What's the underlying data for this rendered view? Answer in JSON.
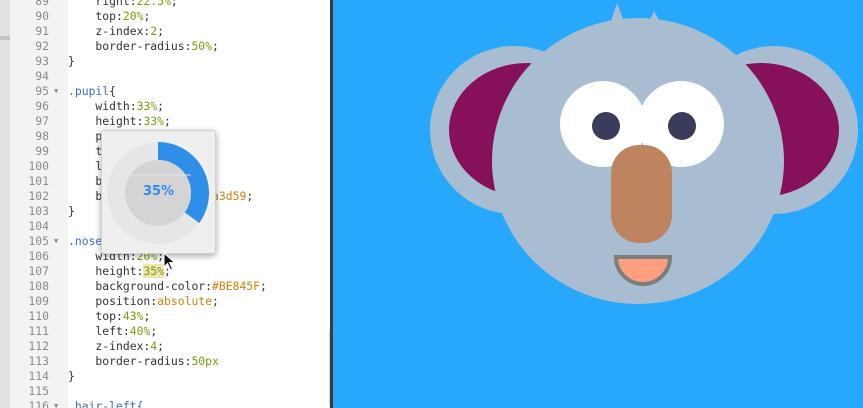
{
  "colors": {
    "editor_bg": "#ffffff",
    "gutter_bg": "#f3f3f3",
    "preview_bg": "#27a8fd",
    "ring_accent": "#2f8ee8",
    "koala_body": "#a8bdd0",
    "koala_ear_inner": "#861059",
    "nose": "#BE845F",
    "pupil": "#3a3d59",
    "mouth": "#ff9f80"
  },
  "editor": {
    "lines": [
      {
        "n": "89",
        "fold": "",
        "segs": [
          {
            "c": "prop",
            "t": "    right:"
          },
          {
            "c": "num-val",
            "t": "22.5%"
          },
          {
            "c": "prop",
            "t": ";"
          }
        ]
      },
      {
        "n": "90",
        "fold": "",
        "segs": [
          {
            "c": "prop",
            "t": "    top:"
          },
          {
            "c": "num-val",
            "t": "20%"
          },
          {
            "c": "prop",
            "t": ";"
          }
        ]
      },
      {
        "n": "91",
        "fold": "",
        "segs": [
          {
            "c": "prop",
            "t": "    z-index:"
          },
          {
            "c": "num-val",
            "t": "2"
          },
          {
            "c": "prop",
            "t": ";"
          }
        ]
      },
      {
        "n": "92",
        "fold": "",
        "segs": [
          {
            "c": "prop",
            "t": "    border-radius:"
          },
          {
            "c": "num-val",
            "t": "50%"
          },
          {
            "c": "prop",
            "t": ";"
          }
        ]
      },
      {
        "n": "93",
        "fold": "",
        "segs": [
          {
            "c": "prop",
            "t": "}"
          }
        ]
      },
      {
        "n": "94",
        "fold": "",
        "segs": []
      },
      {
        "n": "95",
        "fold": "▼",
        "segs": [
          {
            "c": "sel",
            "t": ".pupil"
          },
          {
            "c": "prop",
            "t": "{"
          }
        ]
      },
      {
        "n": "96",
        "fold": "",
        "segs": [
          {
            "c": "prop",
            "t": "    width:"
          },
          {
            "c": "num-val",
            "t": "33%"
          },
          {
            "c": "prop",
            "t": ";"
          }
        ]
      },
      {
        "n": "97",
        "fold": "",
        "segs": [
          {
            "c": "prop",
            "t": "    height:"
          },
          {
            "c": "num-val",
            "t": "33%"
          },
          {
            "c": "prop",
            "t": ";"
          }
        ]
      },
      {
        "n": "98",
        "fold": "",
        "segs": [
          {
            "c": "prop",
            "t": "    p"
          },
          {
            "c": "kw",
            "t": "             e"
          },
          {
            "c": "prop",
            "t": ";"
          }
        ]
      },
      {
        "n": "99",
        "fold": "",
        "segs": [
          {
            "c": "prop",
            "t": "    t"
          }
        ]
      },
      {
        "n": "100",
        "fold": "",
        "segs": [
          {
            "c": "prop",
            "t": "    l"
          }
        ]
      },
      {
        "n": "101",
        "fold": "",
        "segs": [
          {
            "c": "prop",
            "t": "    b"
          },
          {
            "c": "prop",
            "t": "              ;"
          }
        ]
      },
      {
        "n": "102",
        "fold": "",
        "segs": [
          {
            "c": "prop",
            "t": "    b"
          },
          {
            "c": "prop",
            "t": "              "
          },
          {
            "c": "kw",
            "t": "#3a3d59"
          },
          {
            "c": "prop",
            "t": ";"
          }
        ]
      },
      {
        "n": "103",
        "fold": "",
        "segs": [
          {
            "c": "prop",
            "t": "}"
          }
        ]
      },
      {
        "n": "104",
        "fold": "",
        "segs": []
      },
      {
        "n": "105",
        "fold": "▼",
        "segs": [
          {
            "c": "sel",
            "t": ".nose"
          }
        ]
      },
      {
        "n": "106",
        "fold": "",
        "segs": [
          {
            "c": "prop",
            "t": "    width:"
          },
          {
            "c": "num-val",
            "t": "20%"
          },
          {
            "c": "prop",
            "t": ";"
          }
        ]
      },
      {
        "n": "107",
        "fold": "",
        "segs": [
          {
            "c": "prop",
            "t": "    height:"
          },
          {
            "c": "num-val hl",
            "t": "35%"
          },
          {
            "c": "prop",
            "t": ";"
          }
        ]
      },
      {
        "n": "108",
        "fold": "",
        "segs": [
          {
            "c": "prop",
            "t": "    background-color:"
          },
          {
            "c": "kw",
            "t": "#BE845F"
          },
          {
            "c": "prop",
            "t": ";"
          }
        ]
      },
      {
        "n": "109",
        "fold": "",
        "segs": [
          {
            "c": "prop",
            "t": "    position:"
          },
          {
            "c": "kw",
            "t": "absolute"
          },
          {
            "c": "prop",
            "t": ";"
          }
        ]
      },
      {
        "n": "110",
        "fold": "",
        "segs": [
          {
            "c": "prop",
            "t": "    top:"
          },
          {
            "c": "num-val",
            "t": "43%"
          },
          {
            "c": "prop",
            "t": ";"
          }
        ]
      },
      {
        "n": "111",
        "fold": "",
        "segs": [
          {
            "c": "prop",
            "t": "    left:"
          },
          {
            "c": "num-val",
            "t": "40%"
          },
          {
            "c": "prop",
            "t": ";"
          }
        ]
      },
      {
        "n": "112",
        "fold": "",
        "segs": [
          {
            "c": "prop",
            "t": "    z-index:"
          },
          {
            "c": "num-val",
            "t": "4"
          },
          {
            "c": "prop",
            "t": ";"
          }
        ]
      },
      {
        "n": "113",
        "fold": "",
        "segs": [
          {
            "c": "prop",
            "t": "    border-radius:"
          },
          {
            "c": "num-val",
            "t": "50px"
          }
        ]
      },
      {
        "n": "114",
        "fold": "",
        "segs": [
          {
            "c": "prop",
            "t": "}"
          }
        ]
      },
      {
        "n": "115",
        "fold": "",
        "segs": []
      },
      {
        "n": "116",
        "fold": "▼",
        "segs": [
          {
            "c": "sel",
            "t": ".hair-left{"
          }
        ]
      }
    ]
  },
  "popup": {
    "label": "35%",
    "value": 0.35
  },
  "icons": {
    "cursor": "mouse-pointer-icon",
    "fold": "fold-arrow-icon"
  }
}
